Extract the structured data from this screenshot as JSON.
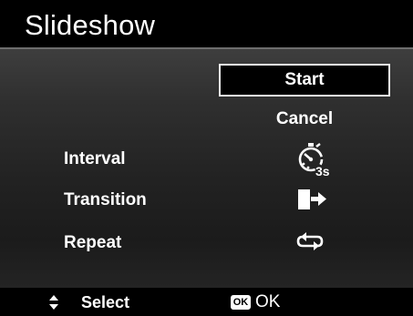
{
  "title": "Slideshow",
  "buttons": {
    "start": "Start",
    "cancel": "Cancel"
  },
  "settings": [
    {
      "label": "Interval",
      "icon": "timer-icon",
      "value": "3s"
    },
    {
      "label": "Transition",
      "icon": "transition-icon"
    },
    {
      "label": "Repeat",
      "icon": "repeat-icon"
    }
  ],
  "footer": {
    "nav_icon": "up-down-arrows-icon",
    "select_label": "Select",
    "ok_badge": "OK",
    "ok_label": "OK"
  },
  "colors": {
    "background": "#000000",
    "panel_top": "#3e3e3e",
    "panel_bottom": "#1b1b1b",
    "text": "#ffffff",
    "divider": "#6e6e6e"
  }
}
